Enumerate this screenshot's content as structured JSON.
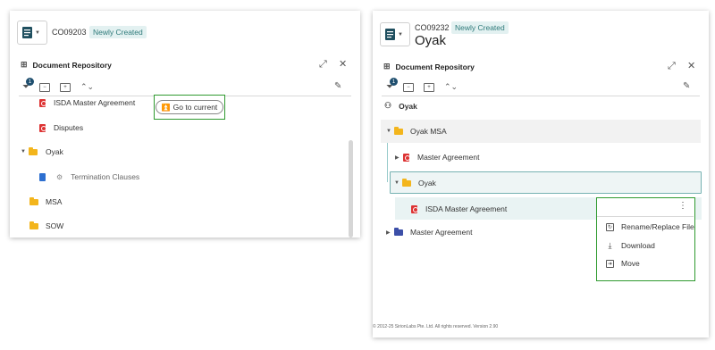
{
  "left": {
    "code": "CO09203",
    "status": "Newly Created",
    "repo_title": "Document Repository",
    "filter_count": "1",
    "goto_label": "Go to current",
    "rows": {
      "isda": "ISDA Master Agreement",
      "disputes": "Disputes",
      "oyak": "Oyak",
      "termination": "Termination Clauses",
      "msa": "MSA",
      "sow": "SOW"
    }
  },
  "right": {
    "code": "CO09232",
    "status": "Newly Created",
    "title": "Oyak",
    "repo_title": "Document Repository",
    "filter_count": "1",
    "entity": "Oyak",
    "rows": {
      "oyak_msa": "Oyak MSA",
      "master1": "Master Agreement",
      "oyak": "Oyak",
      "isda": "ISDA Master Agreement",
      "master2": "Master Agreement"
    },
    "menu": {
      "rename": "Rename/Replace File",
      "download": "Download",
      "move": "Move"
    },
    "footer": "© 2012-25 SirionLabs Pte. Ltd. All rights reserved. Version 2.90"
  },
  "colors": {
    "accent_green": "#2f9a2f",
    "pdf_red": "#d33333",
    "folder_yellow": "#f3b51c",
    "badge_teal": "#2e7a7a"
  },
  "icons": [
    "document-icon",
    "chevron-down-icon",
    "tree-icon",
    "expand-icon",
    "close-icon",
    "filter-icon",
    "collapse-all-icon",
    "expand-all-icon",
    "sort-icon",
    "edit-icon",
    "double-chevron-up-icon",
    "pdf-icon",
    "folder-icon",
    "kebab-icon",
    "rename-icon",
    "download-icon",
    "move-icon"
  ]
}
